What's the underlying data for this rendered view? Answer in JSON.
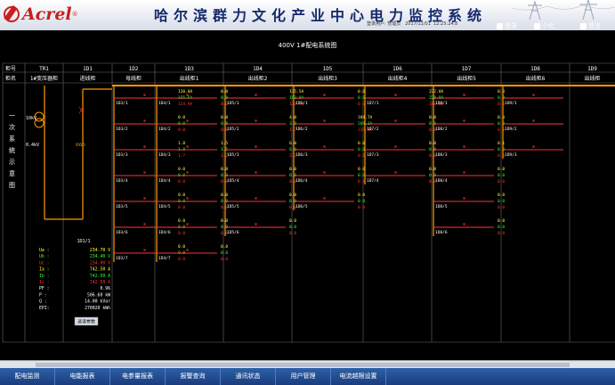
{
  "header": {
    "brand": "Acrel",
    "brand_mark": "®",
    "title": "哈尔滨群力文化产业中心电力监控系统",
    "user_label": "登录用户:",
    "user_name": "管理员",
    "date": "2017/11/01",
    "time": "12:25:24.8",
    "buttons": [
      {
        "label": "登录",
        "icon": "login-icon"
      },
      {
        "label": "小化",
        "icon": "minimize-icon"
      },
      {
        "label": "退出",
        "icon": "exit-icon"
      }
    ]
  },
  "page_title": "400V 1#配电系统图",
  "table": {
    "row_labels": [
      "柜号",
      "柜名"
    ],
    "columns": [
      {
        "id": "TR1",
        "name": "1#变压器柜"
      },
      {
        "id": "1D1",
        "name": "进线柜"
      },
      {
        "id": "1D2",
        "name": "母线柜"
      },
      {
        "id": "1D3",
        "name": "出线柜1"
      },
      {
        "id": "1D4",
        "name": "出线柜2"
      },
      {
        "id": "1D5",
        "name": "出线柜3"
      },
      {
        "id": "1D6",
        "name": "出线柜4"
      },
      {
        "id": "1D7",
        "name": "出线柜5"
      },
      {
        "id": "1D8",
        "name": "出线柜6"
      },
      {
        "id": "1D9",
        "name": "出线柜"
      }
    ],
    "side_label": [
      "一",
      "次",
      "系",
      "统",
      "示",
      "意",
      "图"
    ]
  },
  "transformer": {
    "hv": "10kV",
    "lv": "0.4kV"
  },
  "feeders": [
    {
      "col": 3,
      "rows": [
        {
          "id": "1D3/1",
          "ia": "120.8A",
          "ib": "155.5A",
          "ic": "124.9A"
        },
        {
          "id": "1D3/2",
          "ia": "0.0",
          "ib": "0.0",
          "ic": "0.0"
        },
        {
          "id": "1D3/3",
          "ia": "1.8",
          "ib": "1.8",
          "ic": "1.7"
        },
        {
          "id": "1D3/4",
          "ia": "0.0",
          "ib": "0.0",
          "ic": "0.0"
        },
        {
          "id": "1D3/5",
          "ia": "0.0",
          "ib": "0.0",
          "ic": "0.0"
        },
        {
          "id": "1D3/6",
          "ia": "0.0",
          "ib": "0.0",
          "ic": "0.0"
        },
        {
          "id": "1D3/7",
          "ia": "0.0",
          "ib": "0.0",
          "ic": "0.0"
        }
      ]
    },
    {
      "col": 4,
      "rows": [
        {
          "id": "1D4/1",
          "ia": "0.0",
          "ib": "0.0",
          "ic": "0.0"
        },
        {
          "id": "1D4/2",
          "ia": "0.0",
          "ib": "0.0",
          "ic": "0.0"
        },
        {
          "id": "1D4/3",
          "ia": "1.5",
          "ib": "1.5",
          "ic": "1.2"
        },
        {
          "id": "1D4/4",
          "ia": "0.0",
          "ib": "0.0",
          "ic": "0.0"
        },
        {
          "id": "1D4/5",
          "ia": "0.0",
          "ib": "0.0",
          "ic": "0.0"
        },
        {
          "id": "1D4/6",
          "ia": "0.0",
          "ib": "0.0",
          "ic": "0.0"
        },
        {
          "id": "1D4/7",
          "ia": "0.0",
          "ib": "0.0",
          "ic": "0.0"
        }
      ]
    },
    {
      "col": 5,
      "rows": [
        {
          "id": "1D5/1",
          "ia": "175.5A",
          "ib": "163.8A",
          "ic": "174.7A"
        },
        {
          "id": "1D5/2",
          "ia": "4.0",
          "ib": "3.8",
          "ic": "1.7"
        },
        {
          "id": "1D5/3",
          "ia": "6.0",
          "ib": "6.0",
          "ic": "2.1"
        },
        {
          "id": "1D5/4",
          "ia": "0.0",
          "ib": "0.0",
          "ic": "0.0"
        },
        {
          "id": "1D5/5",
          "ia": "0.0",
          "ib": "0.0",
          "ic": "0.0"
        },
        {
          "id": "1D5/6",
          "ia": "0.0",
          "ib": "0.0",
          "ic": "0.0"
        }
      ]
    },
    {
      "col": 6,
      "rows": [
        {
          "id": "1D6/1",
          "ia": "0.0",
          "ib": "0.0",
          "ic": "0.0"
        },
        {
          "id": "1D6/2",
          "ia": "184.7A",
          "ib": "204.3A",
          "ic": "235.8A"
        },
        {
          "id": "1D6/3",
          "ia": "0.0",
          "ib": "0.0",
          "ic": "0.0"
        },
        {
          "id": "1D6/4",
          "ia": "0.0",
          "ib": "0.0",
          "ic": "0.0"
        },
        {
          "id": "1D6/5",
          "ia": "0.0",
          "ib": "0.0",
          "ic": "0.0"
        }
      ]
    },
    {
      "col": 7,
      "rows": [
        {
          "id": "1D7/1",
          "ia": "232.8A",
          "ib": "228.0A",
          "ic": "180.3A"
        },
        {
          "id": "1D7/2",
          "ia": "0.0",
          "ib": "0.0",
          "ic": "0.0"
        },
        {
          "id": "1D7/3",
          "ia": "0.0",
          "ib": "0.0",
          "ic": "0.0"
        },
        {
          "id": "1D7/4",
          "ia": "0.0",
          "ib": "0.0",
          "ic": "0.0"
        }
      ]
    },
    {
      "col": 8,
      "rows": [
        {
          "id": "1D8/1",
          "ia": "0.0",
          "ib": "0.0",
          "ic": "0.0"
        },
        {
          "id": "1D8/2",
          "ia": "0.0",
          "ib": "0.0",
          "ic": "0.0"
        },
        {
          "id": "1D8/3",
          "ia": "0.1",
          "ib": "0.0",
          "ic": "0.0"
        },
        {
          "id": "1D8/4",
          "ia": "0.0",
          "ib": "0.0",
          "ic": "0.0"
        },
        {
          "id": "1D8/5",
          "ia": "0.0",
          "ib": "0.0",
          "ic": "0.0"
        },
        {
          "id": "1D8/6",
          "ia": "0.0",
          "ib": "0.0",
          "ic": "0.0"
        }
      ]
    },
    {
      "col": 9,
      "rows": [
        {
          "id": "1D9/1",
          "ia": "",
          "ib": "",
          "ic": ""
        },
        {
          "id": "1D9/2",
          "ia": "",
          "ib": "",
          "ic": ""
        },
        {
          "id": "1D9/3",
          "ia": "",
          "ib": "",
          "ic": ""
        }
      ]
    }
  ],
  "meter": {
    "title": "1D1/1",
    "rows": [
      {
        "label": "Ua :",
        "value": "234.70 V",
        "color": "#ffff33"
      },
      {
        "label": "Ub :",
        "value": "234.40 V",
        "color": "#33ff33"
      },
      {
        "label": "Uc :",
        "value": "234.00 V",
        "color": "#ff3333"
      },
      {
        "label": "Ia :",
        "value": "742.50 A",
        "color": "#ffff33"
      },
      {
        "label": "Ib :",
        "value": "742.50 A",
        "color": "#33ff33"
      },
      {
        "label": "Ic :",
        "value": "742.50 A",
        "color": "#ff3333"
      },
      {
        "label": "PF :",
        "value": "0.96",
        "color": "#ffffff"
      },
      {
        "label": "P  :",
        "value": "506.60 kW",
        "color": "#ffffff"
      },
      {
        "label": "Q  :",
        "value": "14.00 kVar",
        "color": "#ffffff"
      },
      {
        "label": "EPI:",
        "value": "270020 kWh",
        "color": "#ffffff"
      }
    ],
    "button": "遥读参数"
  },
  "colors": {
    "bus": "#ff9900",
    "breaker": "#ff3333",
    "a": "#ffff33",
    "b": "#33ff33",
    "c": "#ff3333",
    "grid": "#6b6b6b"
  },
  "nav": [
    "配电监测",
    "电能报表",
    "电参量报表",
    "报警查询",
    "通讯状态",
    "用户管理",
    "电流越限设置"
  ]
}
